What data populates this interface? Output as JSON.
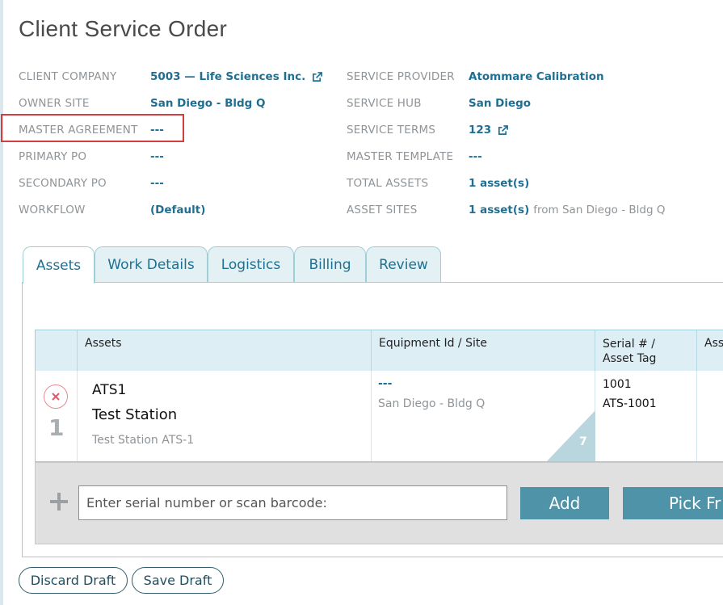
{
  "page": {
    "title": "Client Service Order"
  },
  "fields_left": [
    {
      "label": "CLIENT COMPANY",
      "value": "5003 — Life Sciences Inc.",
      "icon": "external-link-icon"
    },
    {
      "label": "OWNER SITE",
      "value": "San Diego - Bldg Q"
    },
    {
      "label": "MASTER AGREEMENT",
      "value": "---"
    },
    {
      "label": "PRIMARY PO",
      "value": "---"
    },
    {
      "label": "SECONDARY PO",
      "value": "---"
    },
    {
      "label": "WORKFLOW",
      "value": "(Default)"
    }
  ],
  "fields_right": [
    {
      "label": "SERVICE PROVIDER",
      "value": "Atommare Calibration"
    },
    {
      "label": "SERVICE HUB",
      "value": "San Diego"
    },
    {
      "label": "SERVICE TERMS",
      "value": "123",
      "icon": "external-link-icon"
    },
    {
      "label": "MASTER TEMPLATE",
      "value": "---"
    },
    {
      "label": "TOTAL ASSETS",
      "value": "1 asset(s)"
    },
    {
      "label": "ASSET SITES",
      "value": "1 asset(s)",
      "suffix": "from San Diego - Bldg Q"
    }
  ],
  "tabs": [
    "Assets",
    "Work Details",
    "Logistics",
    "Billing",
    "Review"
  ],
  "active_tab": "Assets",
  "table": {
    "headers": [
      "Assets",
      "Equipment Id / Site",
      "Serial # / Asset Tag",
      "Ass"
    ],
    "rows": [
      {
        "number": "1",
        "asset_id": "ATS1",
        "asset_name": "Test Station",
        "asset_desc": "Test Station ATS-1",
        "equipment_id": "---",
        "site": "San Diego - Bldg Q",
        "corner_count": "7",
        "serial": "1001",
        "asset_tag": "ATS-1001"
      }
    ]
  },
  "add_bar": {
    "placeholder": "Enter serial number or scan barcode:",
    "add_label": "Add",
    "pick_label": "Pick Fr"
  },
  "footer": {
    "discard_label": "Discard Draft",
    "save_label": "Save Draft"
  },
  "colors": {
    "accent": "#1f6f92",
    "button": "#4e93a7",
    "highlight": "#d43d3d",
    "tab_border": "#9fcfd6"
  }
}
